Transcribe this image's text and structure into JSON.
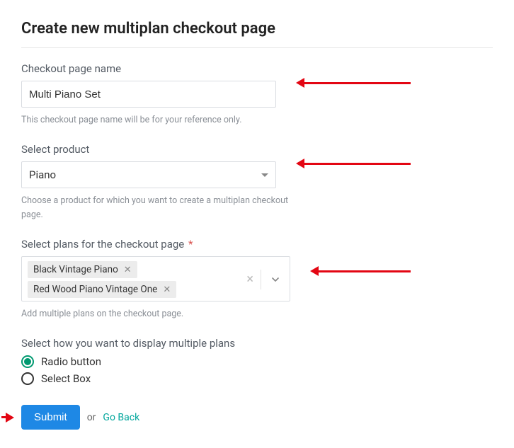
{
  "title": "Create new multiplan checkout page",
  "fields": {
    "checkout_name": {
      "label": "Checkout page name",
      "value": "Multi Piano Set",
      "help": "This checkout page name will be for your reference only."
    },
    "product": {
      "label": "Select product",
      "value": "Piano",
      "help": "Choose a product for which you want to create a multiplan checkout page."
    },
    "plans": {
      "label": "Select plans for the checkout page",
      "required_marker": "*",
      "tags": [
        "Black Vintage Piano",
        "Red Wood Piano Vintage One"
      ],
      "help": "Add multiple plans on the checkout page."
    },
    "display": {
      "label": "Select how you want to display multiple plans",
      "options": [
        "Radio button",
        "Select Box"
      ],
      "selected_index": 0
    }
  },
  "actions": {
    "submit": "Submit",
    "or": "or",
    "go_back": "Go Back"
  },
  "colors": {
    "primary_button": "#1e88e5",
    "radio_accent": "#009970",
    "link": "#00a69c",
    "annotation": "#e30613"
  }
}
